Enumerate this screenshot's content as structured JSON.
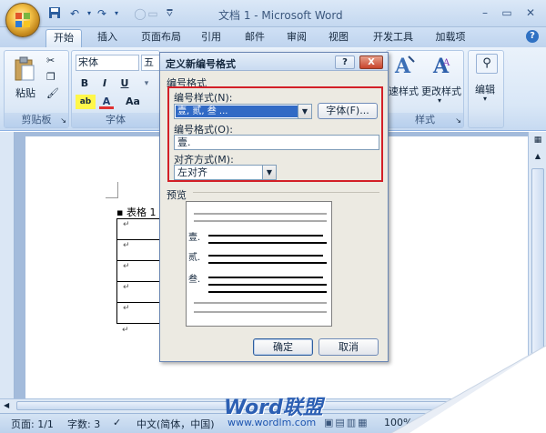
{
  "window": {
    "title": "文档 1 - Microsoft Word"
  },
  "tabs": [
    {
      "label": "开始"
    },
    {
      "label": "插入"
    },
    {
      "label": "页面布局"
    },
    {
      "label": "引用"
    },
    {
      "label": "邮件"
    },
    {
      "label": "审阅"
    },
    {
      "label": "视图"
    },
    {
      "label": "开发工具"
    },
    {
      "label": "加载项"
    }
  ],
  "ribbon": {
    "clipboard": {
      "paste_label": "粘贴",
      "group_label": "剪贴板"
    },
    "font": {
      "font_name": "宋体",
      "font_size": "五",
      "group_label": "字体",
      "bold": "B",
      "italic": "I",
      "underline": "U",
      "text_effects": "A",
      "case": "Aa"
    },
    "styles": {
      "quick_styles_label": "速样式",
      "change_styles_label": "更改样式",
      "group_label": "样式"
    },
    "editing": {
      "label": "编辑"
    }
  },
  "dialog": {
    "title": "定义新编号格式",
    "help": "?",
    "close": "X",
    "section_label": "编号格式",
    "style_label": "编号样式(N):",
    "style_value": "壹, 贰, 叁 ...",
    "font_button": "字体(F)...",
    "format_label": "编号格式(O):",
    "format_value": "壹.",
    "align_label": "对齐方式(M):",
    "align_value": "左对齐",
    "preview_label": "预览",
    "preview_items": [
      "壹.",
      "贰.",
      "叁."
    ],
    "ok": "确定",
    "cancel": "取消"
  },
  "document": {
    "caption": "表格 1",
    "para_mark": "↵"
  },
  "status": {
    "page": "页面: 1/1",
    "words": "字数: 3",
    "language": "中文(简体，中国)",
    "zoom": "100%"
  },
  "watermark": {
    "brand": "Word联盟",
    "url": "www.wordlm.com"
  },
  "colors": {
    "accent": "#2f71c3",
    "highlight_box": "#d31f27",
    "selection": "#316ac5"
  }
}
